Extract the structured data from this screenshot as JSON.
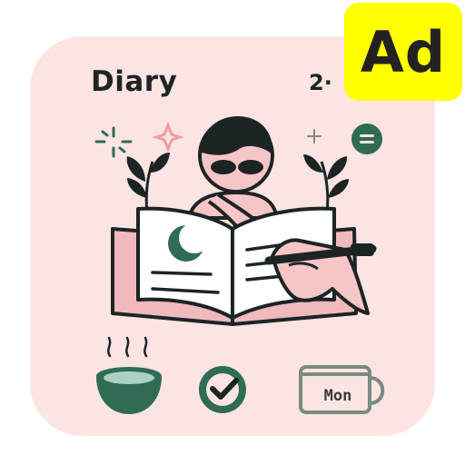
{
  "app": {
    "title": "Diary",
    "date": "2·",
    "ad_label": "Ad",
    "mug_label": "Mon"
  },
  "colors": {
    "background": "#fbe4e1",
    "accent_green": "#2f6b55",
    "ink": "#1d2426",
    "pink": "#f0b9bc",
    "ad_yellow": "#ffff00"
  },
  "icons": [
    "sparkle-icon",
    "plus-icon",
    "menu-icon",
    "leaf-icon",
    "moon-icon",
    "pen-icon",
    "bowl-icon",
    "check-icon",
    "mug-icon"
  ]
}
